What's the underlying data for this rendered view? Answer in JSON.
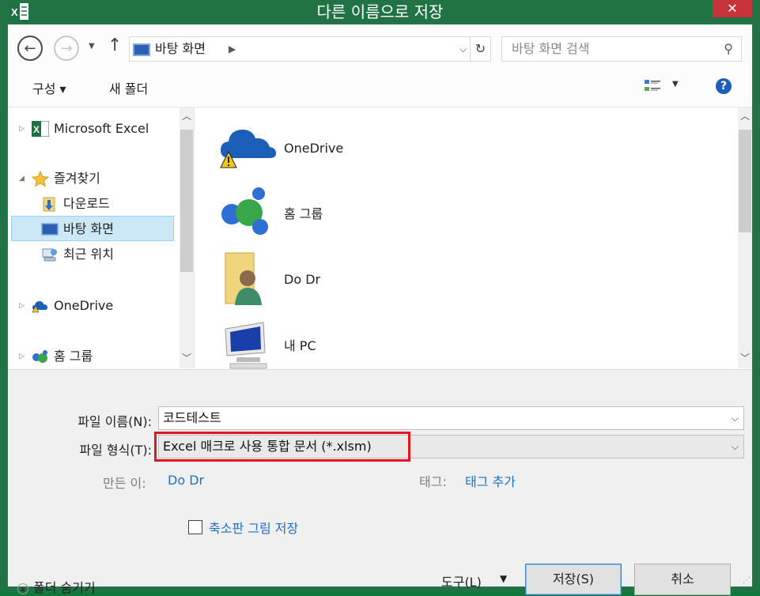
{
  "window": {
    "title": "다른 이름으로 저장",
    "close_glyph": "✕"
  },
  "address_bar": {
    "path": "바탕 화면",
    "crumb_arrow": "▶",
    "dropdown_glyph": "⌵"
  },
  "search": {
    "placeholder": "바탕 화면 검색"
  },
  "toolbar": {
    "organize_label": "구성 ▾",
    "new_folder_label": "새 폴더"
  },
  "nav_pane": {
    "items": [
      {
        "label": "Microsoft Excel",
        "icon": "excel-icon"
      },
      {
        "label": "즐겨찾기",
        "icon": "star-icon"
      },
      {
        "label": "다운로드",
        "icon": "downloads-folder-icon"
      },
      {
        "label": "바탕 화면",
        "icon": "desktop-icon",
        "selected": true
      },
      {
        "label": "최근 위치",
        "icon": "recent-places-icon"
      },
      {
        "label": "OneDrive",
        "icon": "onedrive-icon"
      },
      {
        "label": "홈 그룹",
        "icon": "homegroup-icon"
      }
    ]
  },
  "file_list": {
    "items": [
      {
        "label": "OneDrive",
        "icon": "onedrive-warning-icon"
      },
      {
        "label": "홈 그룹",
        "icon": "homegroup-icon"
      },
      {
        "label": "Do Dr",
        "icon": "user-folder-icon"
      },
      {
        "label": "내 PC",
        "icon": "computer-icon"
      }
    ]
  },
  "form": {
    "filename_label": "파일 이름(N):",
    "filename_value": "코드테스트",
    "filetype_label": "파일 형식(T):",
    "filetype_value": "Excel 매크로 사용 통합 문서 (*.xlsm)",
    "author_label": "만든 이:",
    "author_value": "Do Dr",
    "tags_label": "태그:",
    "tags_value": "태그 추가",
    "thumbnail_label": "축소판 그림 저장",
    "hide_folders_label": "폴더 숨기기",
    "tools_label": "도구(L)",
    "save_label": "저장(S)",
    "cancel_label": "취소"
  },
  "colors": {
    "excel_green": "#217346",
    "highlight_red": "#e01622",
    "link_blue": "#1f6fc5"
  }
}
